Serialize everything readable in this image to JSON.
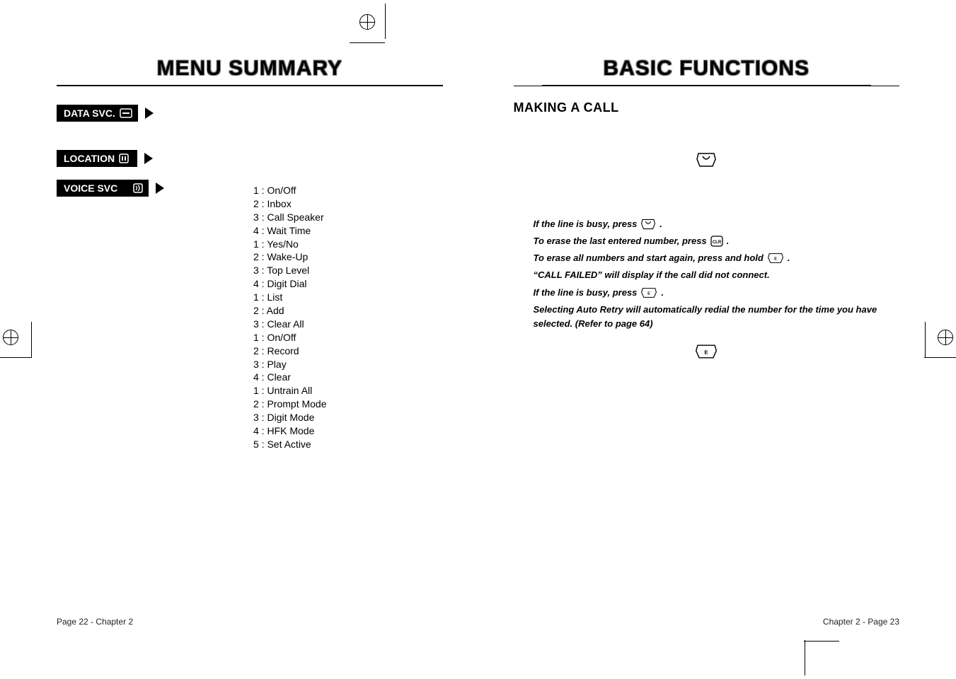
{
  "left_title": "MENU SUMMARY",
  "right_title": "BASIC FUNCTIONS",
  "badges": {
    "data_svc": "DATA SVC.",
    "location": "LOCATION",
    "voice_svc": "VOICE SVC"
  },
  "voice_svc_list": [
    "1 : On/Off",
    "2 : Inbox",
    "3 : Call Speaker",
    "4 : Wait Time",
    "1 : Yes/No",
    "2 : Wake-Up",
    "3 : Top Level",
    "4 : Digit Dial",
    "1 : List",
    "2 : Add",
    "3 : Clear  All",
    "1 : On/Off",
    "2 : Record",
    "3 : Play",
    "4 : Clear",
    "1 : Untrain All",
    "2 : Prompt Mode",
    "3 : Digit Mode",
    "4 : HFK Mode",
    "5 : Set Active"
  ],
  "footer_left": "Page 22 - Chapter 2",
  "footer_right": "Chapter 2 - Page 23",
  "section_heading": "MAKING A CALL",
  "notes": {
    "n1_a": "If the line is busy, press ",
    "n1_b": " .",
    "n2_a": "To erase the last entered number, press ",
    "n2_b": " .",
    "n3_a": "To erase all numbers and start again, press and hold ",
    "n3_b": ".",
    "n4": "“CALL FAILED” will display if the call did not connect.",
    "n5_a": "If the line is busy, press ",
    "n5_b": " .",
    "n6": "Selecting Auto Retry will automatically redial the number for the time you have selected. (Refer to page 64)"
  }
}
